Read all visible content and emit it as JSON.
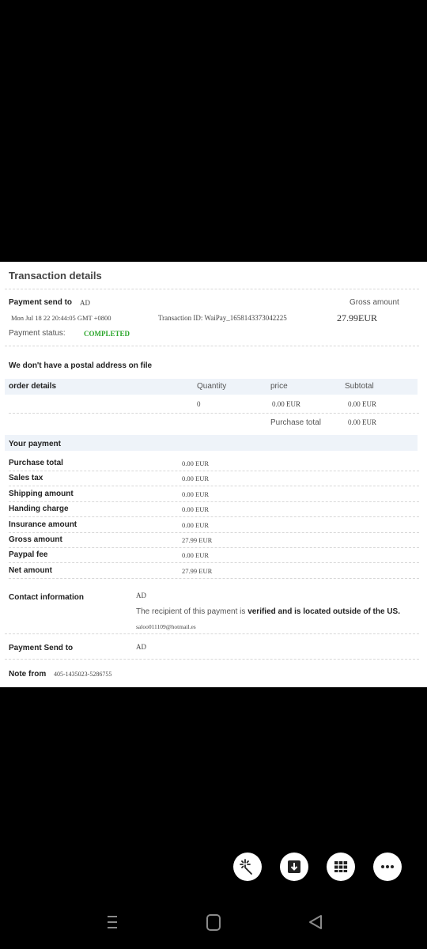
{
  "doc": {
    "title": "Transaction details",
    "payment_send_label": "Payment send to",
    "payment_send_value": "AD",
    "gross_amount_label": "Gross amount",
    "date": "Mon Jul 18 22 20:44:05 GMT +0800",
    "transaction_id": "Transaction ID: WaiPay_1658143373042225",
    "gross_amount_value": "27.99EUR",
    "status_label": "Payment status:",
    "status_value": "COMPLETED",
    "postal_note": "We don't have a postal address on file",
    "order": {
      "label": "order details",
      "col_quantity": "Quantity",
      "col_price": "price",
      "col_subtotal": "Subtotal",
      "quantity": "0",
      "price": "0.00 EUR",
      "subtotal": "0.00 EUR",
      "purchase_total_label": "Purchase total",
      "purchase_total_value": "0.00 EUR"
    },
    "your_payment": {
      "heading": "Your payment",
      "rows": [
        {
          "label": "Purchase total",
          "value": "0.00 EUR"
        },
        {
          "label": "Sales tax",
          "value": "0.00 EUR"
        },
        {
          "label": "Shipping amount",
          "value": "0.00 EUR"
        },
        {
          "label": "Handing charge",
          "value": "0.00 EUR"
        },
        {
          "label": "Insurance amount",
          "value": "0.00 EUR"
        },
        {
          "label": "Gross amount",
          "value": "27.99 EUR"
        },
        {
          "label": "Paypal fee",
          "value": "0.00 EUR"
        },
        {
          "label": "Net amount",
          "value": "27.99 EUR"
        }
      ]
    },
    "contact": {
      "label": "Contact information",
      "name": "AD",
      "note_prefix": "The recipient of this payment is ",
      "note_bold": "verified and is located outside of the US.",
      "email": "saloo011109@hotmail.es"
    },
    "payment_send_to_label": "Payment Send to",
    "payment_send_to_value": "AD",
    "note_label": "Note from",
    "note_value": "405-1435023-5286755"
  },
  "toolbar": {
    "icons": [
      "magic-wand-icon",
      "download-icon",
      "grid-icon",
      "more-icon"
    ]
  },
  "navbar": {
    "icons": [
      "recents-icon",
      "home-icon",
      "back-icon"
    ]
  }
}
